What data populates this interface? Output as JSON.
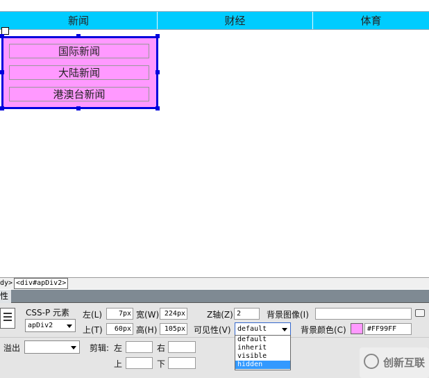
{
  "nav": {
    "items": [
      "新闻",
      "财经",
      "体育"
    ]
  },
  "apdiv": {
    "items": [
      "国际新闻",
      "大陆新闻",
      "港澳台新闻"
    ]
  },
  "tagbar": {
    "crumb_partial": "dy>",
    "selected": "<div#apDiv2>"
  },
  "panel": {
    "title": "性",
    "cssp_label": "CSS-P 元素",
    "element_id": "apDiv2",
    "left_label": "左(L)",
    "left_value": "7px",
    "width_label": "宽(W)",
    "width_value": "224px",
    "top_label": "上(T)",
    "top_value": "60px",
    "height_label": "高(H)",
    "height_value": "105px",
    "z_label": "Z轴(Z)",
    "z_value": "2",
    "bgimage_label": "背景图像(I)",
    "bgimage_value": "",
    "visibility_label": "可见性(V)",
    "visibility_value": "default",
    "visibility_options": [
      "default",
      "inherit",
      "visible",
      "hidden"
    ],
    "visibility_highlighted": "hidden",
    "bgcolor_label": "背景颜色(C)",
    "bgcolor_value": "#FF99FF",
    "overflow_label": "溢出",
    "overflow_value": "",
    "clip_label": "剪辑:",
    "clip_left_label": "左",
    "clip_right_label": "右",
    "clip_top_label": "上",
    "clip_bottom_label": "下",
    "clip_left_value": "",
    "clip_right_value": "",
    "clip_top_value": "",
    "clip_bottom_value": ""
  },
  "colors": {
    "nav_bg": "#00CCFF",
    "apdiv_bg": "#FF99FF",
    "apdiv_border": "#0000DD",
    "highlight": "#3399FF"
  },
  "watermark": {
    "text": "创新互联"
  }
}
